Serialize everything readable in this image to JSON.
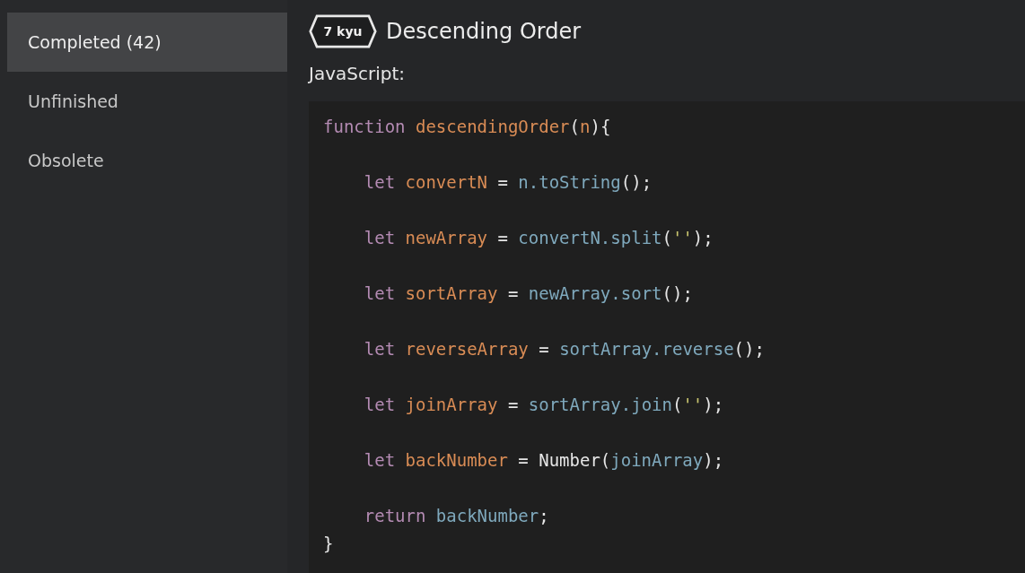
{
  "sidebar": {
    "items": [
      {
        "label": "Completed (42)",
        "selected": true
      },
      {
        "label": "Unfinished",
        "selected": false
      },
      {
        "label": "Obsolete",
        "selected": false
      }
    ]
  },
  "kata": {
    "rank": "7 kyu",
    "title": "Descending Order",
    "language": "JavaScript:"
  },
  "code": {
    "lines": [
      {
        "tokens": [
          {
            "text": "function ",
            "kind": "keyword"
          },
          {
            "text": "descendingOrder",
            "kind": "def"
          },
          {
            "text": "(",
            "kind": "plain"
          },
          {
            "text": "n",
            "kind": "def"
          },
          {
            "text": "){",
            "kind": "plain"
          }
        ]
      },
      {
        "tokens": [
          {
            "text": "    let ",
            "kind": "keyword"
          },
          {
            "text": "convertN",
            "kind": "def"
          },
          {
            "text": " = ",
            "kind": "plain"
          },
          {
            "text": "n.toString",
            "kind": "var"
          },
          {
            "text": "();",
            "kind": "plain"
          }
        ]
      },
      {
        "tokens": [
          {
            "text": "    let ",
            "kind": "keyword"
          },
          {
            "text": "newArray",
            "kind": "def"
          },
          {
            "text": " = ",
            "kind": "plain"
          },
          {
            "text": "convertN.split",
            "kind": "var"
          },
          {
            "text": "(",
            "kind": "plain"
          },
          {
            "text": "''",
            "kind": "string"
          },
          {
            "text": ");",
            "kind": "plain"
          }
        ]
      },
      {
        "tokens": [
          {
            "text": "    let ",
            "kind": "keyword"
          },
          {
            "text": "sortArray",
            "kind": "def"
          },
          {
            "text": " = ",
            "kind": "plain"
          },
          {
            "text": "newArray.sort",
            "kind": "var"
          },
          {
            "text": "();",
            "kind": "plain"
          }
        ]
      },
      {
        "tokens": [
          {
            "text": "    let ",
            "kind": "keyword"
          },
          {
            "text": "reverseArray",
            "kind": "def"
          },
          {
            "text": " = ",
            "kind": "plain"
          },
          {
            "text": "sortArray.reverse",
            "kind": "var"
          },
          {
            "text": "();",
            "kind": "plain"
          }
        ]
      },
      {
        "tokens": [
          {
            "text": "    let ",
            "kind": "keyword"
          },
          {
            "text": "joinArray",
            "kind": "def"
          },
          {
            "text": " = ",
            "kind": "plain"
          },
          {
            "text": "sortArray.join",
            "kind": "var"
          },
          {
            "text": "(",
            "kind": "plain"
          },
          {
            "text": "''",
            "kind": "string"
          },
          {
            "text": ");",
            "kind": "plain"
          }
        ]
      },
      {
        "tokens": [
          {
            "text": "    let ",
            "kind": "keyword"
          },
          {
            "text": "backNumber",
            "kind": "def"
          },
          {
            "text": " = Number(",
            "kind": "plain"
          },
          {
            "text": "joinArray",
            "kind": "var"
          },
          {
            "text": ");",
            "kind": "plain"
          }
        ]
      },
      {
        "tokens": [
          {
            "text": "    return ",
            "kind": "keyword"
          },
          {
            "text": "backNumber",
            "kind": "var"
          },
          {
            "text": ";",
            "kind": "plain"
          }
        ]
      },
      {
        "tokens": [
          {
            "text": "}",
            "kind": "plain"
          }
        ]
      }
    ]
  }
}
